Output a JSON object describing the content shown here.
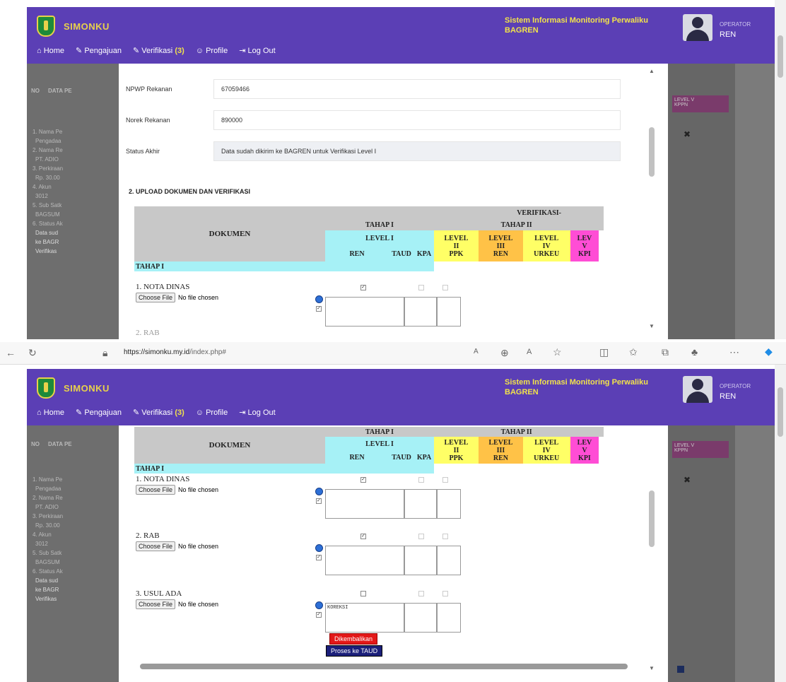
{
  "app": {
    "brand": "SIMONKU",
    "system": "Sistem Informasi Monitoring Perwaliku BAGREN",
    "role": "OPERATOR",
    "user": "REN"
  },
  "nav": {
    "home": "Home",
    "pengajuan": "Pengajuan",
    "verifikasi": "Verifikasi",
    "verifikasi_count": "(3)",
    "profile": "Profile",
    "logout": "Log Out"
  },
  "browser": {
    "url_host": "https://simonku.my.id",
    "url_path": "/index.php#"
  },
  "form": {
    "fields": [
      {
        "label": "NPWP Rekanan",
        "value": "67059466"
      },
      {
        "label": "Norek Rekanan",
        "value": "890000"
      },
      {
        "label": "Status Akhir",
        "value": "Data sudah dikirim ke BAGREN untuk Verifikasi Level I"
      }
    ],
    "section": "2. UPLOAD DOKUMEN DAN VERIFIKASI"
  },
  "table": {
    "verifikasi": "VERIFIKASI-",
    "dokumen": "DOKUMEN",
    "tahap1": "TAHAP I",
    "tahap2": "TAHAP II",
    "level1": "LEVEL I",
    "ren": "REN",
    "taud": "TAUD",
    "kpa": "KPA",
    "l2": "LEVEL",
    "l2n": "II",
    "l2r": "PPK",
    "l3": "LEVEL",
    "l3n": "III",
    "l3r": "REN",
    "l4": "LEVEL",
    "l4n": "IV",
    "l4r": "URKEU",
    "l5": "LEV",
    "l5n": "V",
    "l5r": "KPI",
    "group": "TAHAP I"
  },
  "docs": [
    {
      "name": "1. NOTA DINAS",
      "btn": "Choose File",
      "status": "No file chosen",
      "note": ""
    },
    {
      "name": "2. RAB",
      "btn": "Choose File",
      "status": "No file chosen",
      "note": ""
    },
    {
      "name": "3. USUL ADA",
      "btn": "Choose File",
      "status": "No file chosen",
      "note": "KOREKSI"
    }
  ],
  "buttons": {
    "kembali": "Dikembalikan",
    "proses": "Proses ke TAUD"
  },
  "background": {
    "no": "NO",
    "data": "DATA PE",
    "level5": "LEVEL V",
    "kppn": "KPPN",
    "ghost_rows": [
      "1. Nama Pe",
      "Pengadaa",
      "2. Nama Re",
      "PT. ADIO",
      "3. Perkiraan",
      "Rp. 30.00",
      "4. Akun",
      "3012",
      "5. Sub Satk",
      "BAGSUM",
      "6. Status Ak",
      "Data sud",
      "ke BAGR",
      "Verifikas"
    ],
    "close": "✖"
  }
}
